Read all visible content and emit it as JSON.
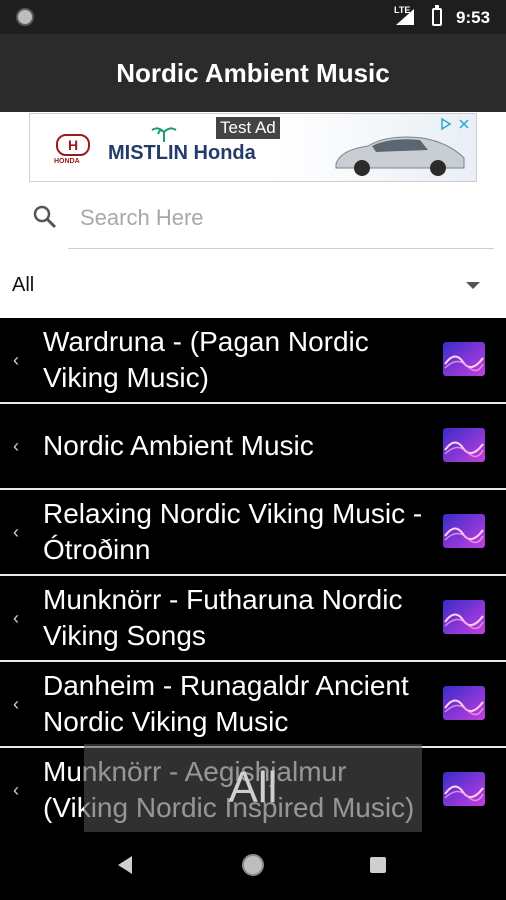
{
  "status_bar": {
    "network": "LTE",
    "time": "9:53"
  },
  "app_bar": {
    "title": "Nordic Ambient Music"
  },
  "ad": {
    "tag": "Test Ad",
    "brand": "MISTLIN Honda",
    "logo_text": "HONDA"
  },
  "search": {
    "placeholder": "Search Here",
    "value": ""
  },
  "filter": {
    "selected": "All"
  },
  "songs": [
    {
      "title": "Wardruna - (Pagan Nordic Viking Music)"
    },
    {
      "title": "Nordic Ambient Music"
    },
    {
      "title": "Relaxing Nordic Viking Music - Ótroðinn"
    },
    {
      "title": "Munknörr - Futharuna Nordic Viking Songs"
    },
    {
      "title": "Danheim - Runagaldr Ancient Nordic Viking Music"
    },
    {
      "title": "Munknörr - Aegishjalmur (Viking Nordic Inspired Music)"
    }
  ],
  "toast": {
    "text": "All"
  },
  "icons": {
    "chevron": "chevron-left-icon",
    "thumb": "wave-thumbnail-icon",
    "search": "search-icon",
    "dropdown": "dropdown-arrow-icon"
  },
  "colors": {
    "thumb_start": "#3a2cc9",
    "thumb_end": "#c23fe0",
    "app_bar": "#2b2b2b"
  }
}
